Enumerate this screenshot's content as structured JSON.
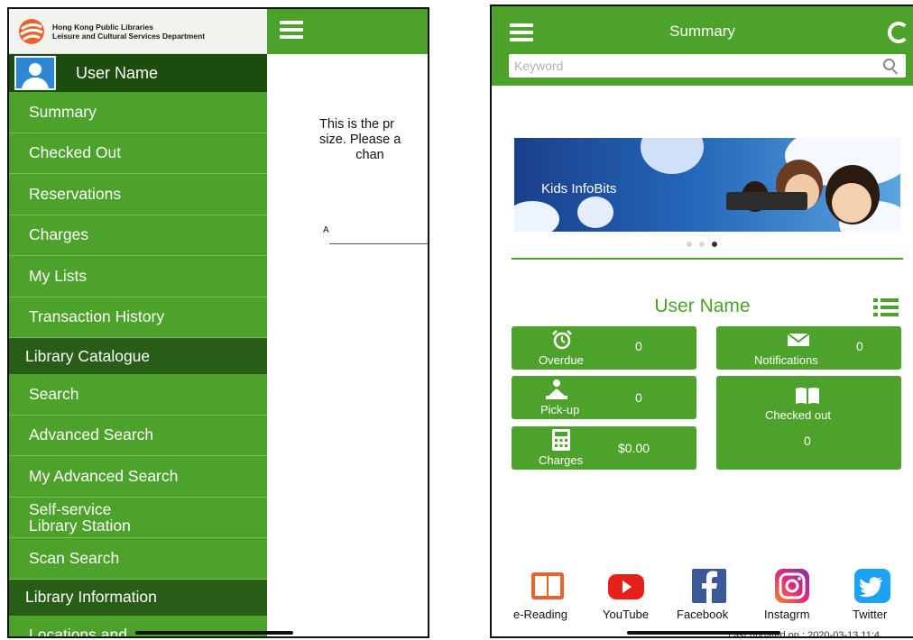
{
  "left_screen": {
    "header": {
      "org_line1": "Hong Kong Public Libraries",
      "org_line2": "Leisure and Cultural Services Department"
    },
    "user_name": "User Name",
    "menu": [
      {
        "type": "item",
        "label": "Summary"
      },
      {
        "type": "item",
        "label": "Checked Out"
      },
      {
        "type": "item",
        "label": "Reservations"
      },
      {
        "type": "item",
        "label": "Charges"
      },
      {
        "type": "item",
        "label": "My Lists"
      },
      {
        "type": "item",
        "label": "Transaction History"
      },
      {
        "type": "section",
        "label": "Library Catalogue"
      },
      {
        "type": "item",
        "label": "Search"
      },
      {
        "type": "item",
        "label": "Advanced Search"
      },
      {
        "type": "item",
        "label": "My Advanced Search"
      },
      {
        "type": "item",
        "label": "Self-service\nLibrary Station"
      },
      {
        "type": "item",
        "label": "Scan Search"
      },
      {
        "type": "section",
        "label": "Library Information"
      },
      {
        "type": "item",
        "label": "Locations and"
      }
    ],
    "main_text": "This is the pr\nsize. Please a\n          chan",
    "main_small": "A"
  },
  "right_screen": {
    "title": "Summary",
    "search_placeholder": "Keyword",
    "banner_text": "Kids InfoBits",
    "carousel": {
      "count": 3,
      "active": 2
    },
    "user_name": "User Name",
    "tiles": {
      "overdue": {
        "label": "Overdue",
        "value": "0"
      },
      "notifications": {
        "label": "Notifications",
        "value": "0"
      },
      "pickup": {
        "label": "Pick-up",
        "value": "0"
      },
      "checked_out": {
        "label": "Checked out",
        "value": "0"
      },
      "charges": {
        "label": "Charges",
        "value": "$0.00"
      }
    },
    "social": [
      {
        "label": "e-Reading",
        "icon": "book-icon",
        "color": "#e8632c"
      },
      {
        "label": "YouTube",
        "icon": "youtube-icon",
        "color": "#e62117"
      },
      {
        "label": "Facebook",
        "icon": "facebook-icon",
        "color": "#3b5998"
      },
      {
        "label": "Instagrm",
        "icon": "instagram-icon",
        "color": "#c1358e"
      },
      {
        "label": "Twitter",
        "icon": "twitter-icon",
        "color": "#1da1f2"
      }
    ],
    "last_updated": "Last updated on : 2020-03-13 11:4"
  },
  "colors": {
    "primary_green": "#4ca22a",
    "dark_green": "#275d16",
    "user_row": "#1d4d0e"
  }
}
